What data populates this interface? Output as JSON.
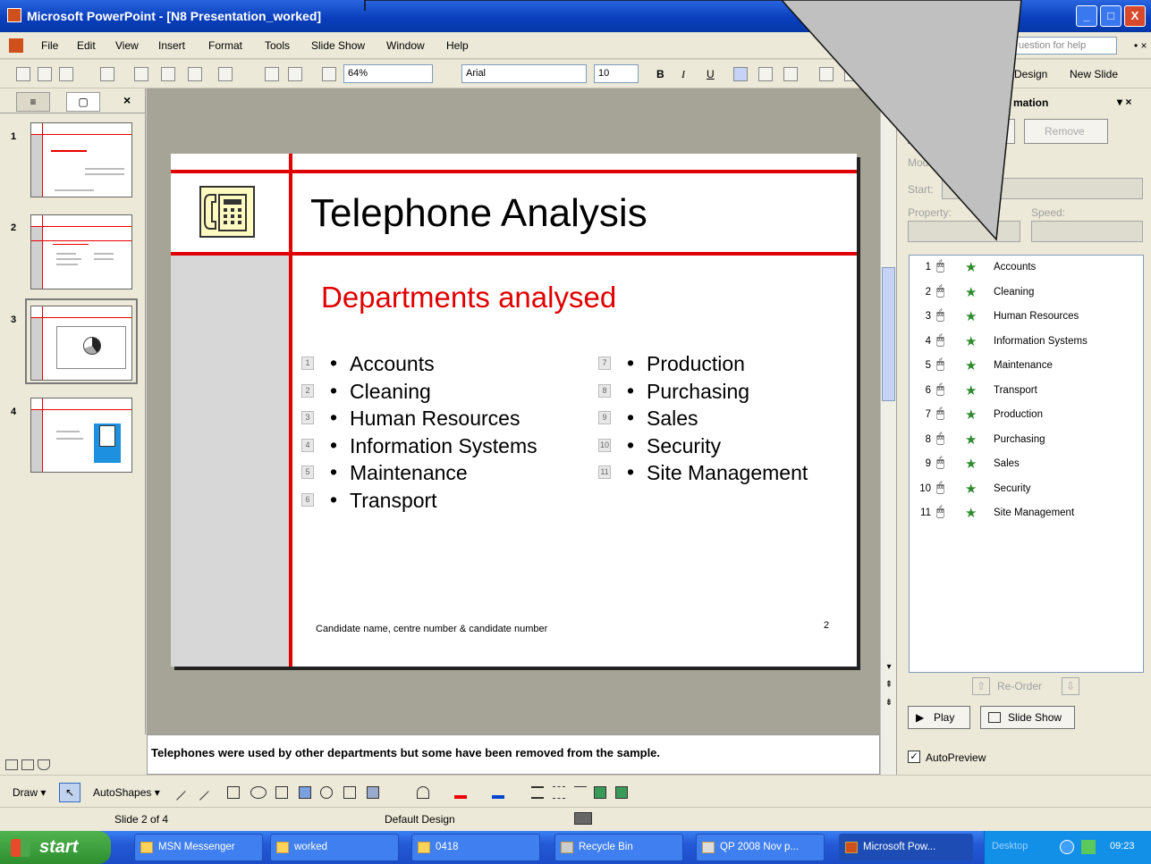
{
  "window": {
    "title": "Microsoft PowerPoint - [N8 Presentation_worked]",
    "minimize": "_",
    "maximize": "□",
    "close": "X"
  },
  "menu": {
    "items": [
      "File",
      "Edit",
      "View",
      "Insert",
      "Format",
      "Tools",
      "Slide Show",
      "Window",
      "Help"
    ],
    "help_placeholder": "uestion for help",
    "close": "• ×"
  },
  "toolbar": {
    "zoom": "64%",
    "font": "Arial",
    "size": "10",
    "bold": "B",
    "italic": "I",
    "underline": "U",
    "design": "Design",
    "new_slide": "New Slide"
  },
  "left_pane": {
    "tab_outline": "≡",
    "tab_slides": "▢",
    "close": "×",
    "slide_numbers": [
      "1",
      "2",
      "3",
      "4"
    ],
    "selected": 2
  },
  "slide": {
    "title": "Telephone Analysis",
    "subtitle": "Departments analysed",
    "left_items": [
      {
        "tag": "1",
        "text": "Accounts"
      },
      {
        "tag": "2",
        "text": "Cleaning"
      },
      {
        "tag": "3",
        "text": "Human Resources"
      },
      {
        "tag": "4",
        "text": "Information Systems"
      },
      {
        "tag": "5",
        "text": "Maintenance"
      },
      {
        "tag": "6",
        "text": "Transport"
      }
    ],
    "right_items": [
      {
        "tag": "7",
        "text": "Production"
      },
      {
        "tag": "8",
        "text": "Purchasing"
      },
      {
        "tag": "9",
        "text": "Sales"
      },
      {
        "tag": "10",
        "text": "Security"
      },
      {
        "tag": "11",
        "text": "Site Management"
      }
    ],
    "footer": "Candidate name, centre number & candidate number",
    "number": "2",
    "bullet": "•",
    "accent": "#e00000"
  },
  "task_pane": {
    "title": "mation",
    "close": "▾ ×",
    "remove": "Remove",
    "modify_label": "Modi",
    "start_label": "Start:",
    "property_label": "Property:",
    "speed_label": "Speed:",
    "animations": [
      {
        "n": "1",
        "name": "Accounts"
      },
      {
        "n": "2",
        "name": "Cleaning"
      },
      {
        "n": "3",
        "name": "Human Resources"
      },
      {
        "n": "4",
        "name": "Information Systems"
      },
      {
        "n": "5",
        "name": "Maintenance"
      },
      {
        "n": "6",
        "name": "Transport"
      },
      {
        "n": "7",
        "name": "Production"
      },
      {
        "n": "8",
        "name": "Purchasing"
      },
      {
        "n": "9",
        "name": "Sales"
      },
      {
        "n": "10",
        "name": "Security"
      },
      {
        "n": "11",
        "name": "Site Management"
      }
    ],
    "reorder": "Re-Order",
    "play": "Play",
    "slide_show": "Slide Show",
    "autopreview": "AutoPreview",
    "autopreview_checked": true
  },
  "notes": {
    "text": "Telephones were used by other departments but some have been removed from the sample."
  },
  "drawing": {
    "draw": "Draw ▾",
    "autoshapes": "AutoShapes ▾"
  },
  "status": {
    "slide": "Slide 2 of 4",
    "design": "Default Design"
  },
  "taskbar": {
    "start": "start",
    "tasks": [
      "MSN Messenger",
      "worked",
      "0418",
      "Recycle Bin",
      "QP 2008 Nov p...",
      "Microsoft Pow..."
    ],
    "active_task": 5,
    "desktop": "Desktop",
    "clock": "09:23"
  },
  "callout": {
    "fill": "#c0c0c0"
  }
}
